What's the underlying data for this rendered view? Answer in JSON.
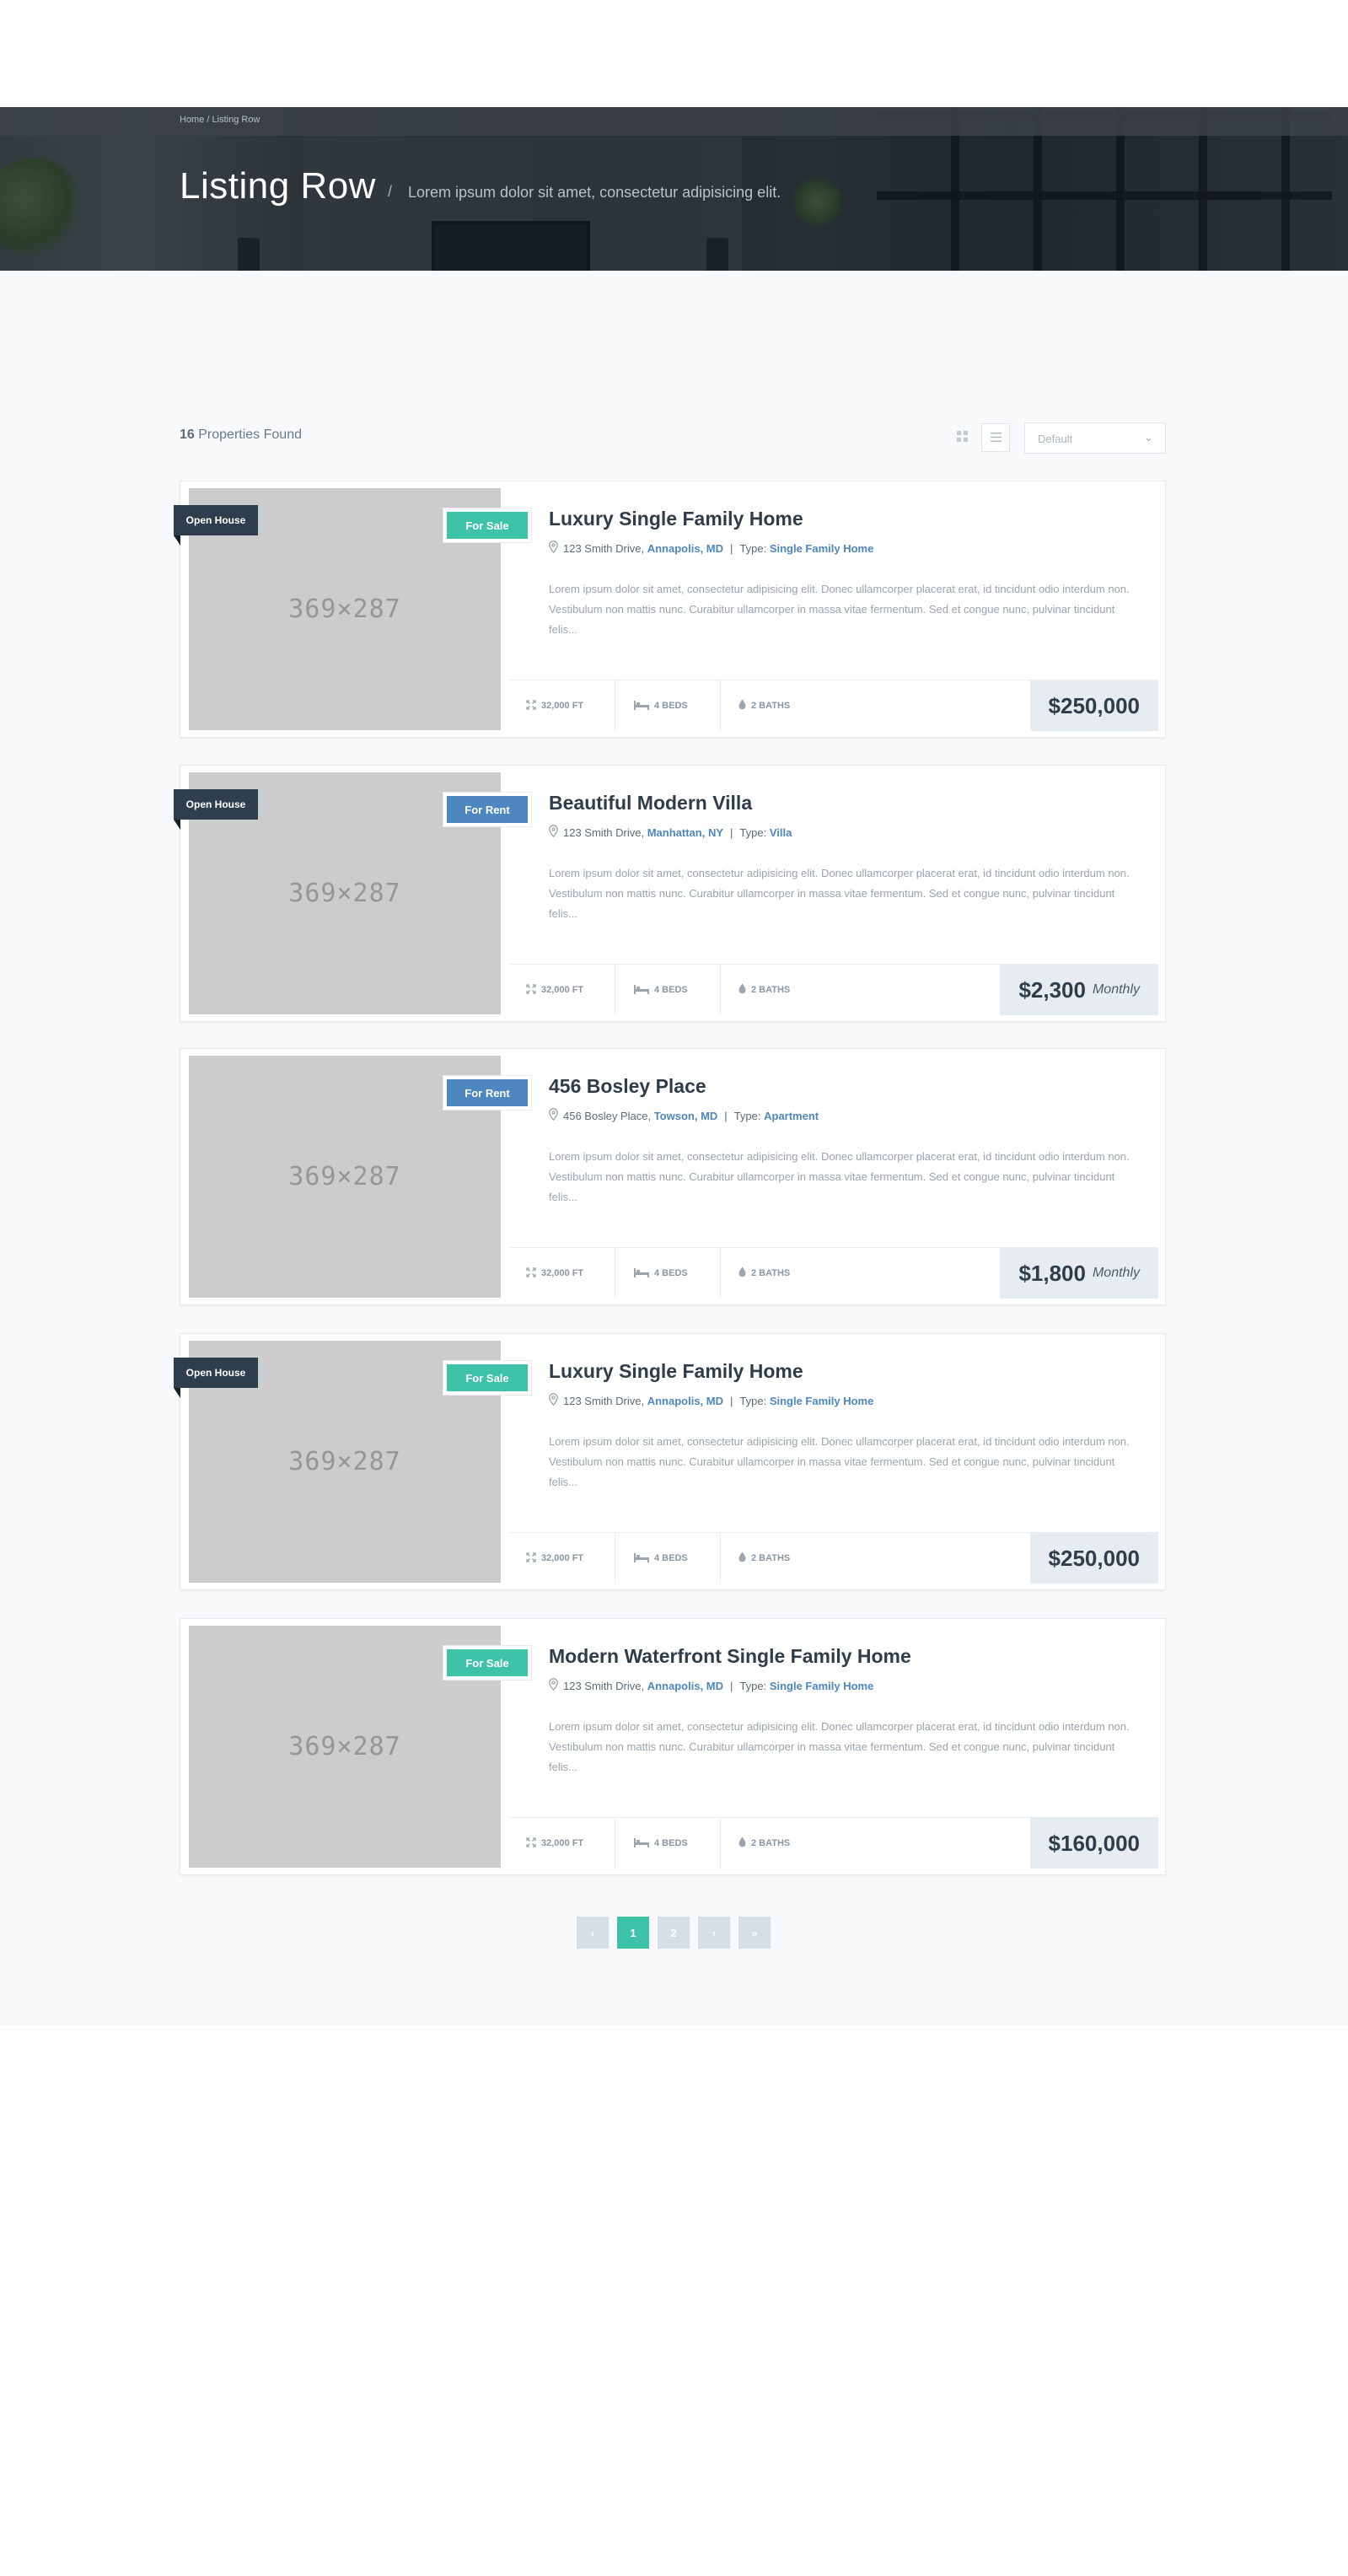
{
  "header": {
    "breadcrumb": {
      "home": "Home",
      "separator": "/",
      "current": "Listing Row"
    },
    "title": "Listing Row",
    "title_separator": "/",
    "subtitle": "Lorem ipsum dolor sit amet, consectetur adipisicing elit."
  },
  "toolbar": {
    "count": "16",
    "count_label": "Properties Found",
    "grid_icon": "grid-icon",
    "list_icon": "list-icon",
    "sort_value": "Default"
  },
  "placeholder_label": "369×287",
  "colors": {
    "for_sale": "#3ec3a9",
    "for_rent": "#4e86bf",
    "open_house": "#2e3e4c",
    "accent": "#4e86bf"
  },
  "listings": [
    {
      "open_house": "Open House",
      "status": "For Sale",
      "title": "Luxury Single Family Home",
      "street": "123 Smith Drive,",
      "city": "Annapolis, MD",
      "type_label": "Type:",
      "type": "Single Family Home",
      "description": "Lorem ipsum dolor sit amet, consectetur adipisicing elit. Donec ullamcorper placerat erat, id tincidunt odio interdum non. Vestibulum non mattis nunc. Curabitur ullamcorper in massa vitae fermentum. Sed et congue nunc, pulvinar tincidunt felis...",
      "area": "32,000 FT",
      "beds": "4 BEDS",
      "baths": "2 BATHS",
      "price": "$250,000",
      "period": ""
    },
    {
      "open_house": "Open House",
      "status": "For Rent",
      "title": "Beautiful Modern Villa",
      "street": "123 Smith Drive,",
      "city": "Manhattan, NY",
      "type_label": "Type:",
      "type": "Villa",
      "description": "Lorem ipsum dolor sit amet, consectetur adipisicing elit. Donec ullamcorper placerat erat, id tincidunt odio interdum non. Vestibulum non mattis nunc. Curabitur ullamcorper in massa vitae fermentum. Sed et congue nunc, pulvinar tincidunt felis...",
      "area": "32,000 FT",
      "beds": "4 BEDS",
      "baths": "2 BATHS",
      "price": "$2,300",
      "period": "Monthly"
    },
    {
      "open_house": "",
      "status": "For Rent",
      "title": "456 Bosley Place",
      "street": "456 Bosley Place,",
      "city": "Towson, MD",
      "type_label": "Type:",
      "type": "Apartment",
      "description": "Lorem ipsum dolor sit amet, consectetur adipisicing elit. Donec ullamcorper placerat erat, id tincidunt odio interdum non. Vestibulum non mattis nunc. Curabitur ullamcorper in massa vitae fermentum. Sed et congue nunc, pulvinar tincidunt felis...",
      "area": "32,000 FT",
      "beds": "4 BEDS",
      "baths": "2 BATHS",
      "price": "$1,800",
      "period": "Monthly"
    },
    {
      "open_house": "Open House",
      "status": "For Sale",
      "title": "Luxury Single Family Home",
      "street": "123 Smith Drive,",
      "city": "Annapolis, MD",
      "type_label": "Type:",
      "type": "Single Family Home",
      "description": "Lorem ipsum dolor sit amet, consectetur adipisicing elit. Donec ullamcorper placerat erat, id tincidunt odio interdum non. Vestibulum non mattis nunc. Curabitur ullamcorper in massa vitae fermentum. Sed et congue nunc, pulvinar tincidunt felis...",
      "area": "32,000 FT",
      "beds": "4 BEDS",
      "baths": "2 BATHS",
      "price": "$250,000",
      "period": ""
    },
    {
      "open_house": "",
      "status": "For Sale",
      "title": "Modern Waterfront Single Family Home",
      "street": "123 Smith Drive,",
      "city": "Annapolis, MD",
      "type_label": "Type:",
      "type": "Single Family Home",
      "description": "Lorem ipsum dolor sit amet, consectetur adipisicing elit. Donec ullamcorper placerat erat, id tincidunt odio interdum non. Vestibulum non mattis nunc. Curabitur ullamcorper in massa vitae fermentum. Sed et congue nunc, pulvinar tincidunt felis...",
      "area": "32,000 FT",
      "beds": "4 BEDS",
      "baths": "2 BATHS",
      "price": "$160,000",
      "period": ""
    }
  ],
  "pagination": {
    "prev": "‹",
    "pages": [
      "1",
      "2"
    ],
    "active": "1",
    "next": "›",
    "last": "»"
  }
}
